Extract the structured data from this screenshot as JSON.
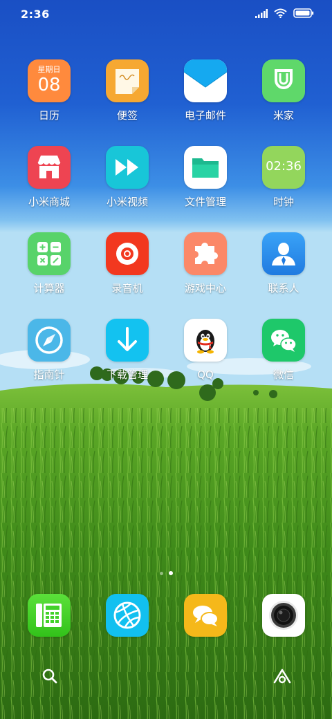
{
  "status_bar": {
    "time": "2:36",
    "icons": [
      "signal-icon",
      "wifi-icon",
      "battery-icon"
    ]
  },
  "apps": [
    {
      "label": "日历",
      "icon": "calendar-icon",
      "color": "#ff8a3d",
      "calendar_day": "星期日",
      "calendar_date": "08"
    },
    {
      "label": "便签",
      "icon": "notes-icon",
      "color": "#f6a832"
    },
    {
      "label": "电子邮件",
      "icon": "email-icon",
      "color": "#ffffff"
    },
    {
      "label": "米家",
      "icon": "mijia-icon",
      "color": "#5fd86a"
    },
    {
      "label": "小米商城",
      "icon": "store-icon",
      "color": "#ee4452"
    },
    {
      "label": "小米视频",
      "icon": "video-icon",
      "color": "#18c6d8"
    },
    {
      "label": "文件管理",
      "icon": "folder-icon",
      "color": "#ffffff"
    },
    {
      "label": "时钟",
      "icon": "clock-icon",
      "color": "#93d65c",
      "clock_text": "02:36"
    },
    {
      "label": "计算器",
      "icon": "calculator-icon",
      "color": "#58d36a"
    },
    {
      "label": "录音机",
      "icon": "recorder-icon",
      "color": "#f2381f"
    },
    {
      "label": "游戏中心",
      "icon": "puzzle-icon",
      "color": "#fb8868"
    },
    {
      "label": "联系人",
      "icon": "contacts-icon",
      "color": "#2f8ff0"
    },
    {
      "label": "指南针",
      "icon": "compass-icon",
      "color": "#4bb7e8"
    },
    {
      "label": "下载管理",
      "icon": "download-icon",
      "color": "#13c2f0"
    },
    {
      "label": "QQ",
      "icon": "qq-penguin-icon",
      "color": "#ffffff"
    },
    {
      "label": "微信",
      "icon": "wechat-icon",
      "color": "#1ec86a"
    }
  ],
  "page_indicator": {
    "pages": 2,
    "active": 2
  },
  "dock": [
    {
      "icon": "phone-icon",
      "color": "#42d12a"
    },
    {
      "icon": "browser-icon",
      "color": "#12c0f0"
    },
    {
      "icon": "messages-icon",
      "color": "#f5b81a"
    },
    {
      "icon": "camera-icon",
      "color": "#ffffff"
    }
  ],
  "bottom_bar": [
    "search-icon",
    "assistant-icon"
  ]
}
